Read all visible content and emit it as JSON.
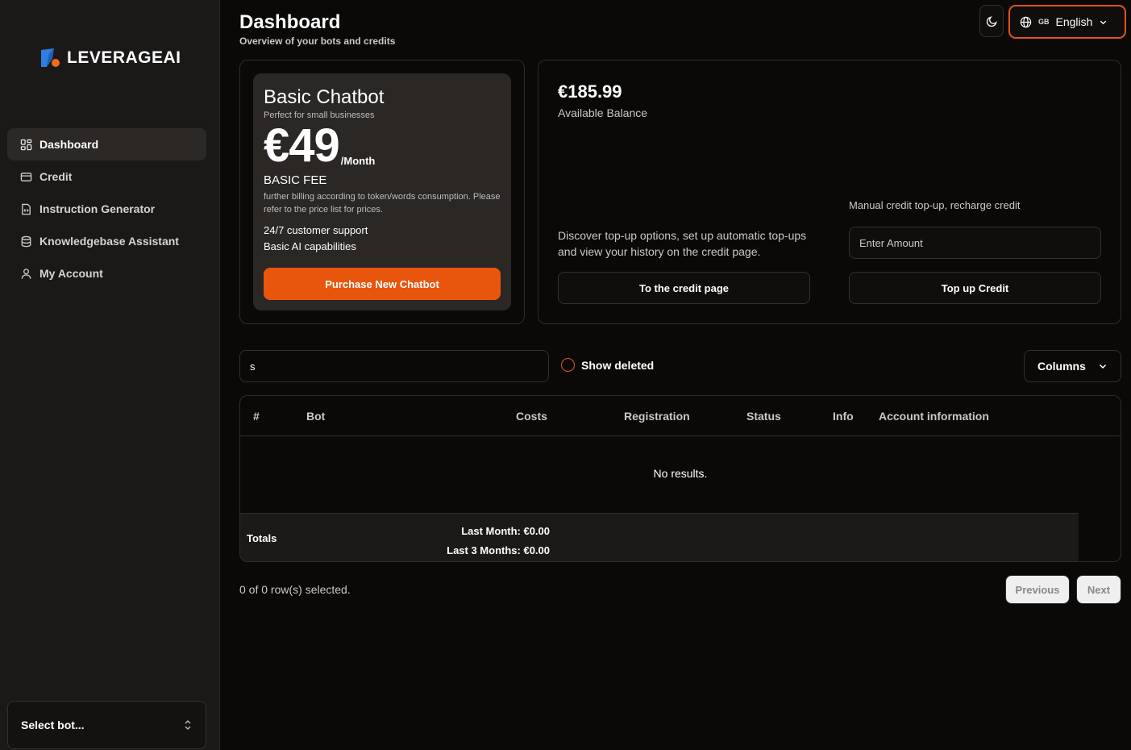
{
  "sidebar": {
    "logo_text": "LEVERAGEAI",
    "items": [
      {
        "label": "Dashboard",
        "icon": "dashboard-icon"
      },
      {
        "label": "Credit",
        "icon": "credit-card-icon"
      },
      {
        "label": "Instruction Generator",
        "icon": "file-code-icon"
      },
      {
        "label": "Knowledgebase Assistant",
        "icon": "database-icon"
      },
      {
        "label": "My Account",
        "icon": "user-icon"
      }
    ],
    "bot_select": "Select bot..."
  },
  "header": {
    "title": "Dashboard",
    "subtitle": "Overview of your bots and credits",
    "language_flag": "GB",
    "language": "English"
  },
  "plan": {
    "name": "Basic Chatbot",
    "description": "Perfect for small businesses",
    "price": "€49",
    "period": "/Month",
    "fee_label": "BASIC FEE",
    "fee_note": "further billing according to token/words consumption. Please refer to the price list for prices.",
    "features": [
      "24/7 customer support",
      "Basic AI capabilities"
    ],
    "button": "Purchase New Chatbot"
  },
  "credit": {
    "balance": "€185.99",
    "balance_label": "Available Balance",
    "discover_text": "Discover top-up options, set up automatic top-ups and view your history on the credit page.",
    "to_credit_button": "To the credit page",
    "manual_label": "Manual credit top-up, recharge credit",
    "amount_placeholder": "Enter Amount",
    "topup_button": "Top up Credit"
  },
  "filters": {
    "search_value": "s",
    "show_deleted": "Show deleted",
    "columns_button": "Columns"
  },
  "table": {
    "columns": [
      "#",
      "Bot",
      "Costs",
      "Registration",
      "Status",
      "Info",
      "Account information"
    ],
    "empty_text": "No results.",
    "totals_label": "Totals",
    "last_month": "Last Month: €0.00",
    "last_3_months": "Last 3 Months: €0.00"
  },
  "pagination": {
    "selected_info": "0 of 0 row(s) selected.",
    "previous": "Previous",
    "next": "Next"
  },
  "colors": {
    "accent": "#e8560e",
    "background": "#0a0908",
    "sidebar": "#1b1918"
  }
}
